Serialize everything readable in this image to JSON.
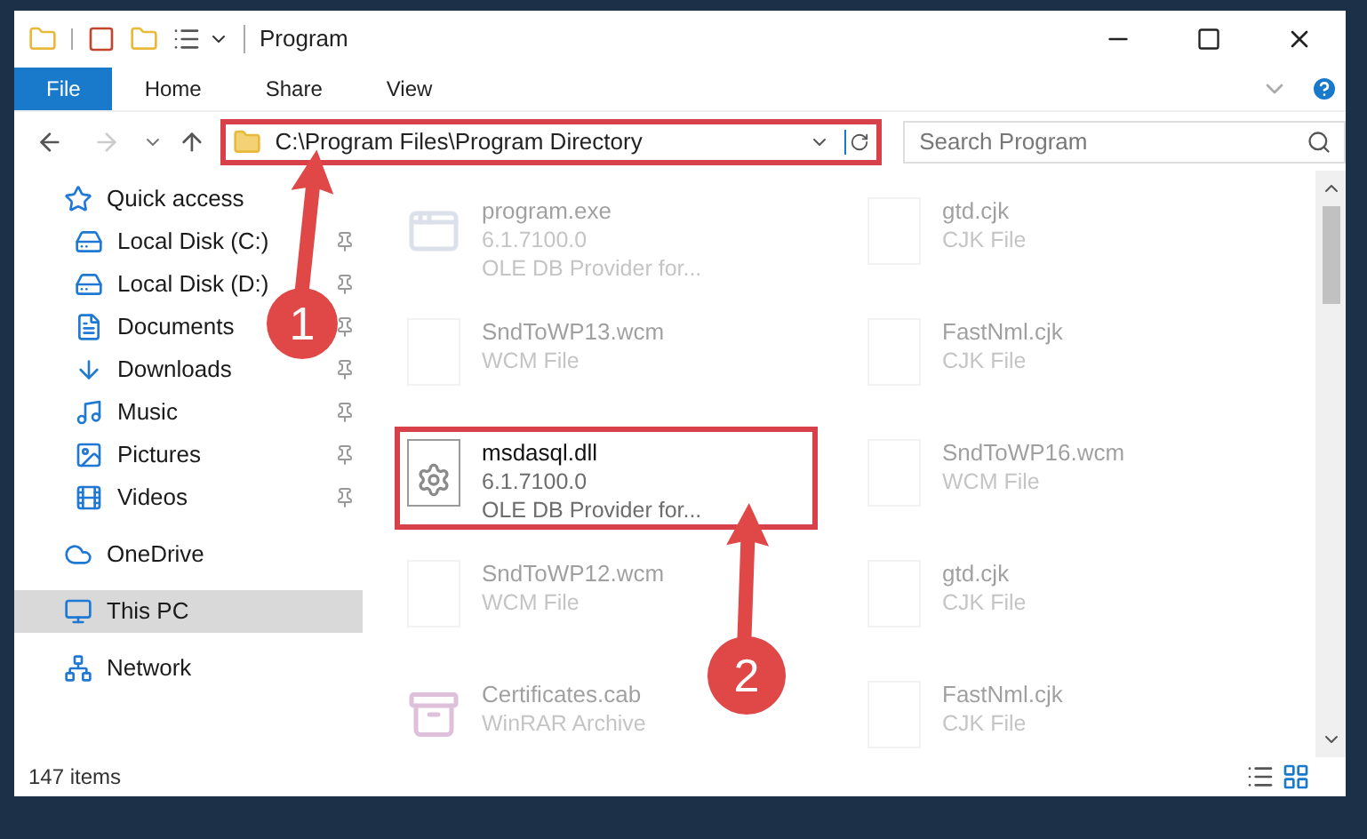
{
  "window": {
    "title": "Program"
  },
  "ribbon_tabs": [
    {
      "label": "File",
      "selected": true
    },
    {
      "label": "Home",
      "selected": false
    },
    {
      "label": "Share",
      "selected": false
    },
    {
      "label": "View",
      "selected": false
    }
  ],
  "address_bar": {
    "path": "C:\\Program Files\\Program Directory",
    "highlighted": true
  },
  "search": {
    "placeholder": "Search Program"
  },
  "sidebar": {
    "items": [
      {
        "label": "Quick access",
        "selected": false,
        "children": [
          {
            "label": "Local Disk (C:)",
            "pinned": true
          },
          {
            "label": "Local Disk (D:)",
            "pinned": true
          },
          {
            "label": "Documents",
            "pinned": true
          },
          {
            "label": "Downloads",
            "pinned": true
          },
          {
            "label": "Music",
            "pinned": true
          },
          {
            "label": "Pictures",
            "pinned": true
          },
          {
            "label": "Videos",
            "pinned": true
          }
        ]
      },
      {
        "label": "OneDrive",
        "selected": false
      },
      {
        "label": "This PC",
        "selected": true
      },
      {
        "label": "Network",
        "selected": false
      }
    ]
  },
  "files": [
    {
      "kind": "exe",
      "name": "program.exe",
      "lines": [
        "6.1.7100.0",
        "OLE DB Provider for..."
      ],
      "faded": true,
      "highlighted": false
    },
    {
      "kind": "doc",
      "name": "gtd.cjk",
      "lines": [
        "CJK File"
      ],
      "faded": true,
      "highlighted": false
    },
    {
      "kind": "doc",
      "name": "SndToWP13.wcm",
      "lines": [
        "WCM File"
      ],
      "faded": true,
      "highlighted": false
    },
    {
      "kind": "doc",
      "name": "FastNml.cjk",
      "lines": [
        "CJK File"
      ],
      "faded": true,
      "highlighted": false
    },
    {
      "kind": "dll",
      "name": "msdasql.dll",
      "lines": [
        "6.1.7100.0",
        "OLE DB Provider for..."
      ],
      "faded": false,
      "highlighted": true
    },
    {
      "kind": "doc",
      "name": "SndToWP16.wcm",
      "lines": [
        "WCM File"
      ],
      "faded": true,
      "highlighted": false
    },
    {
      "kind": "doc",
      "name": "SndToWP12.wcm",
      "lines": [
        "WCM File"
      ],
      "faded": true,
      "highlighted": false
    },
    {
      "kind": "doc",
      "name": "gtd.cjk",
      "lines": [
        "CJK File"
      ],
      "faded": true,
      "highlighted": false
    },
    {
      "kind": "archive",
      "name": "Certificates.cab",
      "lines": [
        "WinRAR Archive"
      ],
      "faded": true,
      "highlighted": false
    },
    {
      "kind": "doc",
      "name": "FastNml.cjk",
      "lines": [
        "CJK File"
      ],
      "faded": true,
      "highlighted": false
    }
  ],
  "status_bar": {
    "item_count": "147 items"
  },
  "annotations": [
    {
      "label": "1"
    },
    {
      "label": "2"
    }
  ]
}
